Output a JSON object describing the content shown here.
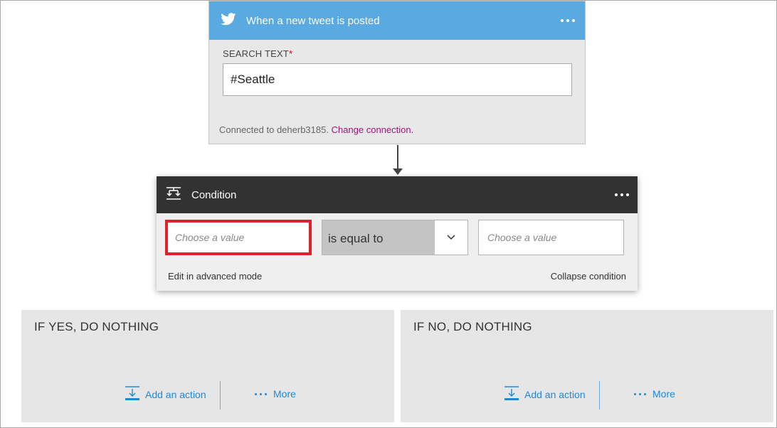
{
  "trigger": {
    "title": "When a new tweet is posted",
    "icon": "twitter-bird-icon",
    "header_color": "#5aa9e0",
    "search_label": "SEARCH TEXT",
    "required_marker": "*",
    "search_value": "#Seattle",
    "connected_text": "Connected to deherb3185.",
    "change_connection": "Change connection."
  },
  "condition": {
    "title": "Condition",
    "icon": "condition-icon",
    "left_placeholder": "Choose a value",
    "operator": "is equal to",
    "right_placeholder": "Choose a value",
    "advanced_mode": "Edit in advanced mode",
    "collapse": "Collapse condition",
    "highlight_color": "#e0202a"
  },
  "branches": [
    {
      "title": "IF YES, DO NOTHING",
      "add_action": "Add an action",
      "more": "More"
    },
    {
      "title": "IF NO, DO NOTHING",
      "add_action": "Add an action",
      "more": "More"
    }
  ]
}
